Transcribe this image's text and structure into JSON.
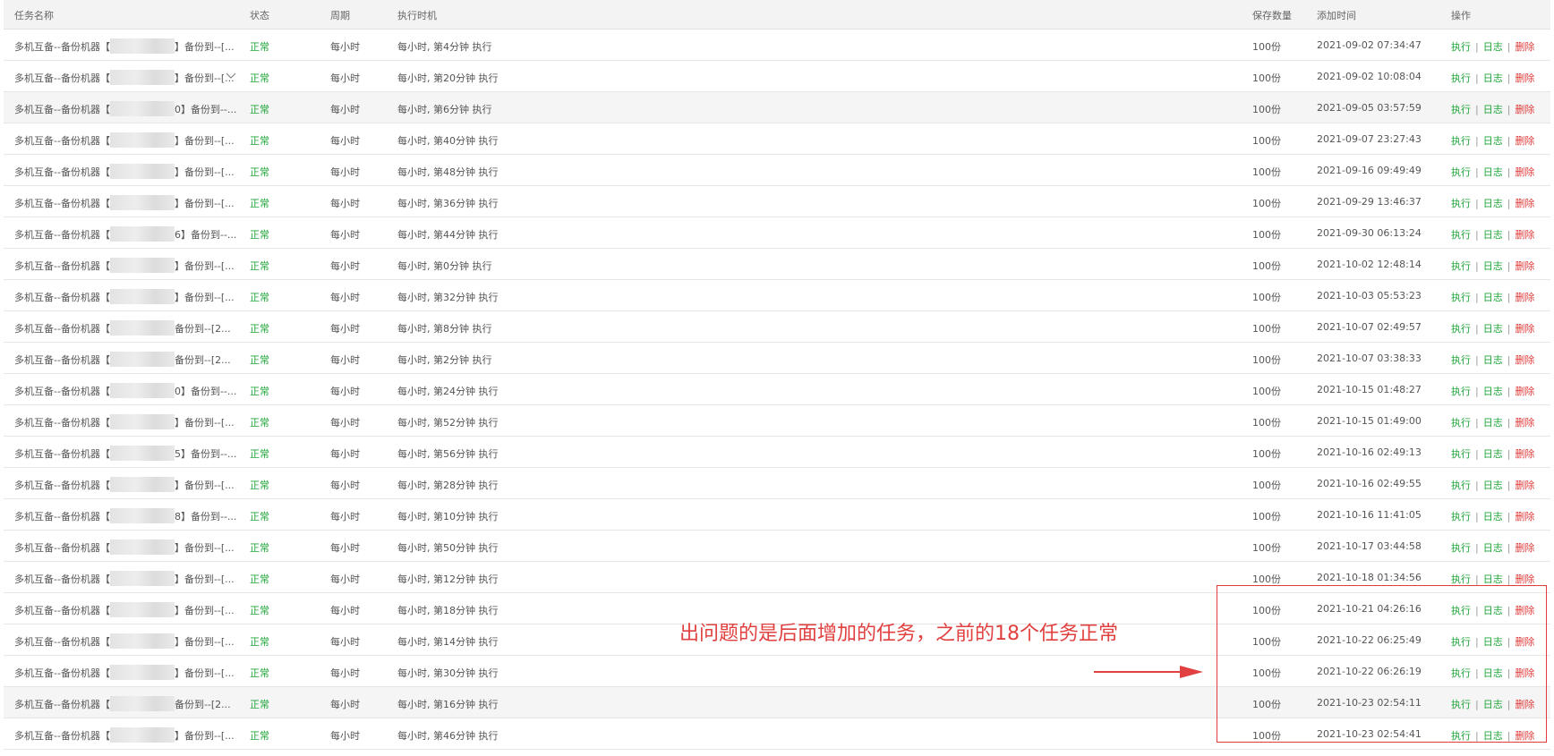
{
  "headers": {
    "name": "任务名称",
    "status": "状态",
    "cycle": "周期",
    "exec": "执行时机",
    "keep": "保存数量",
    "time": "添加时间",
    "ops": "操作"
  },
  "ops_labels": {
    "run": "执行",
    "log": "日志",
    "delete": "删除",
    "sep": "|"
  },
  "rows": [
    {
      "name_a": "多机互备--备份机器【",
      "name_b": "】备份到--[...",
      "status": "正常",
      "cycle": "每小时",
      "exec": "每小时, 第4分钟 执行",
      "keep": "100份",
      "time": "2021-09-02 07:34:47"
    },
    {
      "name_a": "多机互备--备份机器【",
      "name_b": "】备份到--[...",
      "status": "正常",
      "cycle": "每小时",
      "exec": "每小时, 第20分钟 执行",
      "keep": "100份",
      "time": "2021-09-02 10:08:04"
    },
    {
      "name_a": "多机互备--备份机器【",
      "name_b": "0】备份到--...",
      "status": "正常",
      "cycle": "每小时",
      "exec": "每小时, 第6分钟 执行",
      "keep": "100份",
      "time": "2021-09-05 03:57:59"
    },
    {
      "name_a": "多机互备--备份机器【",
      "name_b": "】备份到--[...",
      "status": "正常",
      "cycle": "每小时",
      "exec": "每小时, 第40分钟 执行",
      "keep": "100份",
      "time": "2021-09-07 23:27:43"
    },
    {
      "name_a": "多机互备--备份机器【",
      "name_b": "】备份到--[...",
      "status": "正常",
      "cycle": "每小时",
      "exec": "每小时, 第48分钟 执行",
      "keep": "100份",
      "time": "2021-09-16 09:49:49"
    },
    {
      "name_a": "多机互备--备份机器【",
      "name_b": "】备份到--[...",
      "status": "正常",
      "cycle": "每小时",
      "exec": "每小时, 第36分钟 执行",
      "keep": "100份",
      "time": "2021-09-29 13:46:37"
    },
    {
      "name_a": "多机互备--备份机器【",
      "name_b": "6】备份到--...",
      "status": "正常",
      "cycle": "每小时",
      "exec": "每小时, 第44分钟 执行",
      "keep": "100份",
      "time": "2021-09-30 06:13:24"
    },
    {
      "name_a": "多机互备--备份机器【",
      "name_b": "】备份到--[...",
      "status": "正常",
      "cycle": "每小时",
      "exec": "每小时, 第0分钟 执行",
      "keep": "100份",
      "time": "2021-10-02 12:48:14"
    },
    {
      "name_a": "多机互备--备份机器【",
      "name_b": "】备份到--[...",
      "status": "正常",
      "cycle": "每小时",
      "exec": "每小时, 第32分钟 执行",
      "keep": "100份",
      "time": "2021-10-03 05:53:23"
    },
    {
      "name_a": "多机互备--备份机器【",
      "name_b": "备份到--[2...",
      "status": "正常",
      "cycle": "每小时",
      "exec": "每小时, 第8分钟 执行",
      "keep": "100份",
      "time": "2021-10-07 02:49:57"
    },
    {
      "name_a": "多机互备--备份机器【",
      "name_b": "备份到--[2...",
      "status": "正常",
      "cycle": "每小时",
      "exec": "每小时, 第2分钟 执行",
      "keep": "100份",
      "time": "2021-10-07 03:38:33"
    },
    {
      "name_a": "多机互备--备份机器【",
      "name_b": "0】备份到--...",
      "status": "正常",
      "cycle": "每小时",
      "exec": "每小时, 第24分钟 执行",
      "keep": "100份",
      "time": "2021-10-15 01:48:27"
    },
    {
      "name_a": "多机互备--备份机器【",
      "name_b": "】备份到--[...",
      "status": "正常",
      "cycle": "每小时",
      "exec": "每小时, 第52分钟 执行",
      "keep": "100份",
      "time": "2021-10-15 01:49:00"
    },
    {
      "name_a": "多机互备--备份机器【",
      "name_b": "5】备份到--...",
      "status": "正常",
      "cycle": "每小时",
      "exec": "每小时, 第56分钟 执行",
      "keep": "100份",
      "time": "2021-10-16 02:49:13"
    },
    {
      "name_a": "多机互备--备份机器【",
      "name_b": "】备份到--[...",
      "status": "正常",
      "cycle": "每小时",
      "exec": "每小时, 第28分钟 执行",
      "keep": "100份",
      "time": "2021-10-16 02:49:55"
    },
    {
      "name_a": "多机互备--备份机器【",
      "name_b": "8】备份到--...",
      "status": "正常",
      "cycle": "每小时",
      "exec": "每小时, 第10分钟 执行",
      "keep": "100份",
      "time": "2021-10-16 11:41:05"
    },
    {
      "name_a": "多机互备--备份机器【",
      "name_b": "】备份到--[...",
      "status": "正常",
      "cycle": "每小时",
      "exec": "每小时, 第50分钟 执行",
      "keep": "100份",
      "time": "2021-10-17 03:44:58"
    },
    {
      "name_a": "多机互备--备份机器【",
      "name_b": "】备份到--[...",
      "status": "正常",
      "cycle": "每小时",
      "exec": "每小时, 第12分钟 执行",
      "keep": "100份",
      "time": "2021-10-18 01:34:56"
    },
    {
      "name_a": "多机互备--备份机器【",
      "name_b": "】备份到--[...",
      "status": "正常",
      "cycle": "每小时",
      "exec": "每小时, 第18分钟 执行",
      "keep": "100份",
      "time": "2021-10-21 04:26:16"
    },
    {
      "name_a": "多机互备--备份机器【",
      "name_b": "】备份到--[...",
      "status": "正常",
      "cycle": "每小时",
      "exec": "每小时, 第14分钟 执行",
      "keep": "100份",
      "time": "2021-10-22 06:25:49"
    },
    {
      "name_a": "多机互备--备份机器【",
      "name_b": "】备份到--[...",
      "status": "正常",
      "cycle": "每小时",
      "exec": "每小时, 第30分钟 执行",
      "keep": "100份",
      "time": "2021-10-22 06:26:19"
    },
    {
      "name_a": "多机互备--备份机器【",
      "name_b": "备份到--[2...",
      "status": "正常",
      "cycle": "每小时",
      "exec": "每小时, 第16分钟 执行",
      "keep": "100份",
      "time": "2021-10-23 02:54:11"
    },
    {
      "name_a": "多机互备--备份机器【",
      "name_b": "】备份到--[...",
      "status": "正常",
      "cycle": "每小时",
      "exec": "每小时, 第46分钟 执行",
      "keep": "100份",
      "time": "2021-10-23 02:54:41"
    }
  ],
  "annotation": {
    "text": "出问题的是后面增加的任务，之前的18个任务正常",
    "color": "#e0403f"
  },
  "colors": {
    "status_ok": "#20a53a",
    "op_green": "#20a53a",
    "op_red": "#e03b3b",
    "annotation_red": "#e23b3b"
  },
  "icons": {
    "row_dropdown": "chevron-down-icon",
    "annotation_arrow": "arrow-right-icon"
  }
}
